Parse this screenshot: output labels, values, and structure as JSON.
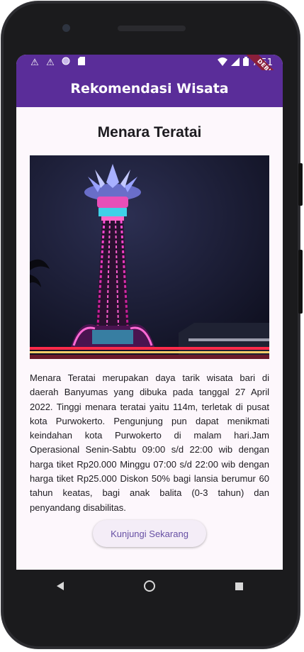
{
  "status_bar": {
    "time": "7:51",
    "left_icons": [
      "warning-icon",
      "warning-icon",
      "circle-icon",
      "sd-card-icon"
    ],
    "right_icons": [
      "wifi-icon",
      "signal-icon",
      "battery-icon"
    ]
  },
  "app_bar": {
    "title": "Rekomendasi Wisata"
  },
  "debug_banner": "DEBUG",
  "place": {
    "title": "Menara Teratai",
    "description": "Menara Teratai merupakan daya tarik wisata bari di daerah Banyumas yang dibuka pada tanggal 27 April 2022. Tinggi menara teratai yaitu 114m, terletak di pusat kota Purwokerto. Pengunjung pun dapat menikmati keindahan kota Purwokerto di malam hari.Jam Operasional Senin-Sabtu 09:00 s/d 22:00 wib dengan harga tiket Rp20.000 Minggu 07:00 s/d 22:00 wib dengan harga tiket Rp25.000 Diskon 50% bagi lansia berumur 60 tahun keatas, bagi anak balita (0-3 tahun) dan penyandang disabilitas.",
    "button_label": "Kunjungi Sekarang"
  },
  "colors": {
    "app_bar": "#5a2d99",
    "background": "#fdf7fc",
    "button_text": "#6750a4"
  },
  "nav_icons": [
    "back-icon",
    "home-icon",
    "recent-apps-icon"
  ]
}
